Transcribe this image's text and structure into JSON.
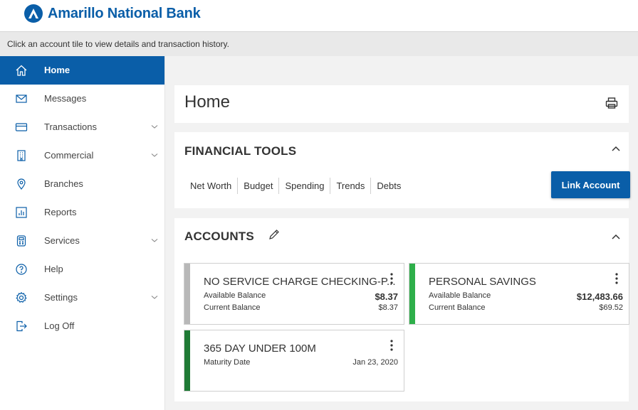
{
  "bank": {
    "name": "Amarillo National Bank"
  },
  "info_text": "Click an account tile to view details and transaction history.",
  "nav": {
    "items": [
      {
        "label": "Home",
        "icon": "home-icon",
        "active": true
      },
      {
        "label": "Messages",
        "icon": "mail-icon"
      },
      {
        "label": "Transactions",
        "icon": "card-icon",
        "expandable": true
      },
      {
        "label": "Commercial",
        "icon": "building-icon",
        "expandable": true
      },
      {
        "label": "Branches",
        "icon": "location-pin-icon"
      },
      {
        "label": "Reports",
        "icon": "bar-chart-icon"
      },
      {
        "label": "Services",
        "icon": "calculator-icon",
        "expandable": true
      },
      {
        "label": "Help",
        "icon": "help-icon"
      },
      {
        "label": "Settings",
        "icon": "gear-icon",
        "expandable": true
      },
      {
        "label": "Log Off",
        "icon": "logout-icon"
      }
    ]
  },
  "home": {
    "title": "Home"
  },
  "tools": {
    "title": "FINANCIAL TOOLS",
    "links": [
      "Net Worth",
      "Budget",
      "Spending",
      "Trends",
      "Debts"
    ],
    "link_account_label": "Link Account"
  },
  "accounts": {
    "title": "ACCOUNTS",
    "tiles": [
      {
        "name": "NO SERVICE CHARGE CHECKING-P...",
        "accent": "#b8b8b8",
        "rows": [
          {
            "label": "Available Balance",
            "value": "$8.37"
          },
          {
            "label": "Current Balance",
            "value": "$8.37"
          }
        ]
      },
      {
        "name": "PERSONAL SAVINGS",
        "accent": "#2eaf4a",
        "rows": [
          {
            "label": "Available Balance",
            "value": "$12,483.66"
          },
          {
            "label": "Current Balance",
            "value": "$69.52"
          }
        ]
      },
      {
        "name": "365 DAY UNDER 100M",
        "accent": "#1f7a35",
        "rows": [
          {
            "label": "Maturity Date",
            "value": "Jan 23, 2020"
          }
        ]
      }
    ]
  },
  "colors": {
    "brand": "#0a5ea8",
    "checking": "#b8b8b8",
    "savings": "#2eaf4a",
    "cd": "#1f7a35"
  }
}
